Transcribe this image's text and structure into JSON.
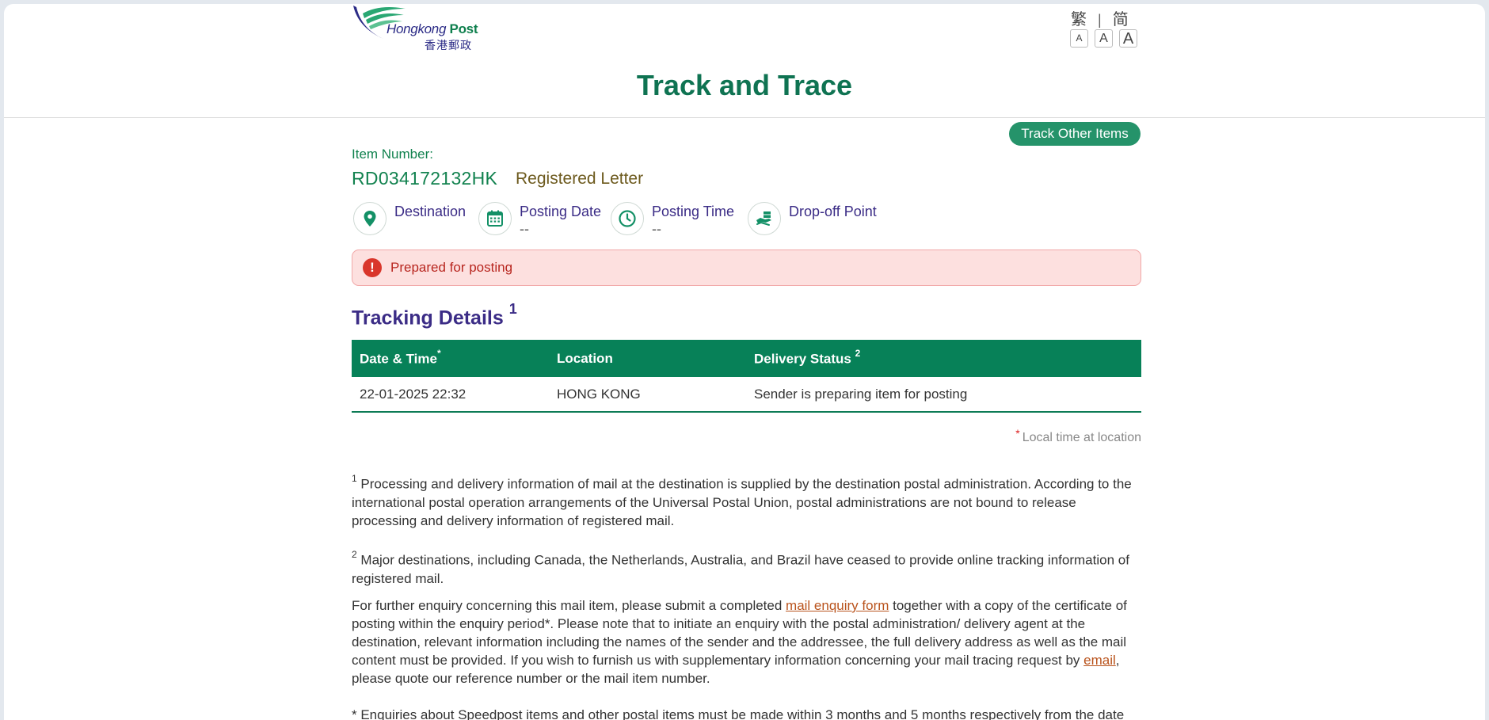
{
  "header": {
    "logo_en_1": "Hongkong",
    "logo_en_2": "Post",
    "logo_zh": "香港郵政",
    "lang_trad": "繁",
    "lang_sep": "|",
    "lang_simp": "简",
    "font_small": "A",
    "font_medium": "A",
    "font_large": "A"
  },
  "title": "Track and Trace",
  "track_other_button": "Track Other Items",
  "item": {
    "label": "Item Number:",
    "number": "RD034172132HK",
    "type": "Registered Letter"
  },
  "info": {
    "destination": "Destination",
    "posting_date": "Posting Date",
    "posting_date_value": "--",
    "posting_time": "Posting Time",
    "posting_time_value": "--",
    "dropoff": "Drop-off Point"
  },
  "alert": {
    "icon": "!",
    "text": "Prepared for posting"
  },
  "tracking": {
    "heading": "Tracking Details",
    "heading_sup": "1",
    "columns": {
      "datetime": "Date & Time",
      "datetime_sup": "*",
      "location": "Location",
      "status": "Delivery Status",
      "status_sup": "2"
    },
    "rows": [
      {
        "datetime": "22-01-2025 22:32",
        "location": "HONG KONG",
        "status": "Sender is preparing item for posting"
      }
    ]
  },
  "local_note": {
    "star": "*",
    "text": "Local time at location"
  },
  "notes": {
    "n1_sup": "1",
    "n1": " Processing and delivery information of mail at the destination is supplied by the destination postal administration. According to the international postal operation arrangements of the Universal Postal Union, postal administrations are not bound to release processing and delivery information of registered mail.",
    "n2_sup": "2",
    "n2": " Major destinations, including Canada, the Netherlands, Australia, and Brazil have ceased to provide online tracking information of registered mail.",
    "enquiry_1": "For further enquiry concerning this mail item, please submit a completed ",
    "enquiry_link": "mail enquiry form",
    "enquiry_2": " together with a copy of the certificate of posting within the enquiry period*. Please note that to initiate an enquiry with the postal administration/ delivery agent at the destination, relevant information including the names of the sender and the addressee, the full delivery address as well as the mail content must be provided. If you wish to furnish us with supplementary information concerning your mail tracing request by ",
    "email_link": "email",
    "enquiry_3": ", please quote our reference number or the mail item number.",
    "period": "* Enquiries about Speedpost items and other postal items must be made within 3 months and 5 months respectively from the date"
  },
  "colors": {
    "brand_green": "#078158",
    "title_green": "#0f7352",
    "purple": "#3b2c86",
    "alert_bg": "#fde0df",
    "alert_red": "#d9362b",
    "link": "#b9531c"
  }
}
